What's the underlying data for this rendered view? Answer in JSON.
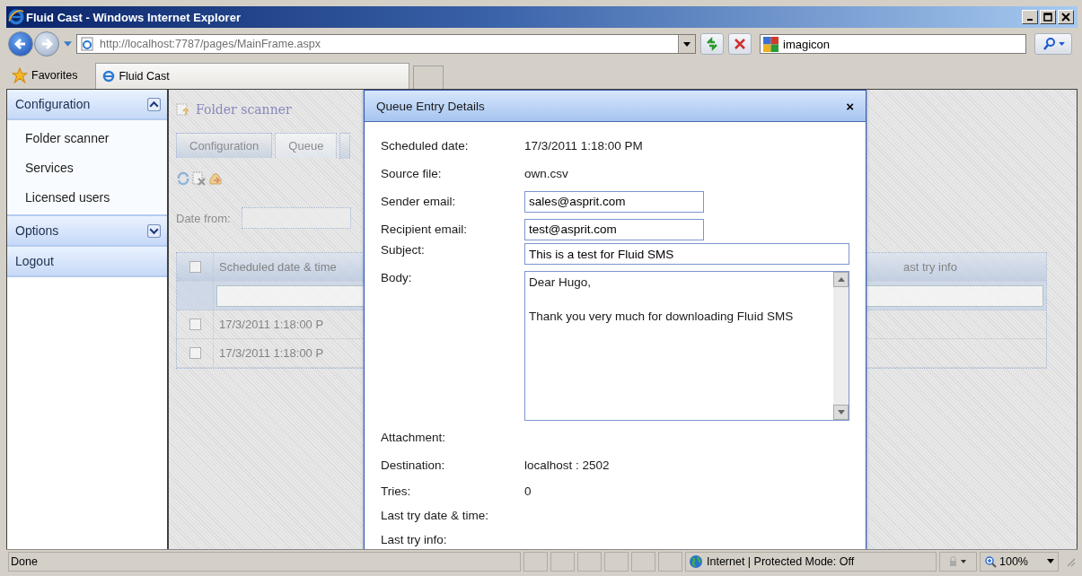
{
  "window": {
    "title": "Fluid Cast - Windows Internet Explorer"
  },
  "address_bar": {
    "url": "http://localhost:7787/pages/MainFrame.aspx",
    "search": "imagicon"
  },
  "favorites_bar": {
    "label": "Favorites",
    "tabs": [
      {
        "label": "Fluid Cast",
        "selected": true
      }
    ]
  },
  "sidebar": {
    "sections": [
      {
        "label": "Configuration",
        "kind": "group",
        "expanded": true,
        "items": [
          "Folder scanner",
          "Services",
          "Licensed users"
        ]
      },
      {
        "label": "Options",
        "kind": "group",
        "expanded": false
      },
      {
        "label": "Logout",
        "kind": "link"
      }
    ]
  },
  "page": {
    "title": "Folder scanner",
    "tabs": [
      {
        "label": "Configuration",
        "selected": false
      },
      {
        "label": "Queue",
        "selected": true
      }
    ],
    "filter_label": "Date from:",
    "table": {
      "all_checked": false,
      "columns": [
        "Scheduled date & time",
        "ast try info"
      ],
      "rows": [
        {
          "checked": false,
          "cells": [
            "17/3/2011 1:18:00 P"
          ]
        },
        {
          "checked": false,
          "cells": [
            "17/3/2011 1:18:00 P"
          ]
        }
      ]
    }
  },
  "dialog": {
    "title": "Queue Entry Details",
    "close": "×",
    "fields": [
      {
        "label": "Scheduled date:",
        "kind": "text",
        "value": "17/3/2011 1:18:00 PM"
      },
      {
        "label": "Source file:",
        "kind": "text",
        "value": "own.csv"
      },
      {
        "label": "Sender email:",
        "kind": "input",
        "value": "sales@asprit.com"
      },
      {
        "label": "Recipient email:",
        "kind": "input",
        "value": "test@asprit.com"
      },
      {
        "label": "Subject:",
        "kind": "wide-input",
        "value": "This is a test for Fluid SMS"
      },
      {
        "label": "Body:",
        "kind": "textarea",
        "value": "Dear Hugo,\n\nThank you very much for downloading Fluid SMS"
      },
      {
        "label": "Attachment:",
        "kind": "text"
      },
      {
        "label": "Destination:",
        "kind": "text",
        "value": "localhost : 2502"
      },
      {
        "label": "Tries:",
        "kind": "text",
        "value": "0"
      },
      {
        "label": "Last try date & time:",
        "kind": "text"
      },
      {
        "label": "Last try info:",
        "kind": "text"
      }
    ]
  },
  "status_bar": {
    "text": "Done",
    "zone": "Internet | Protected Mode: Off",
    "zoom": "100%"
  }
}
